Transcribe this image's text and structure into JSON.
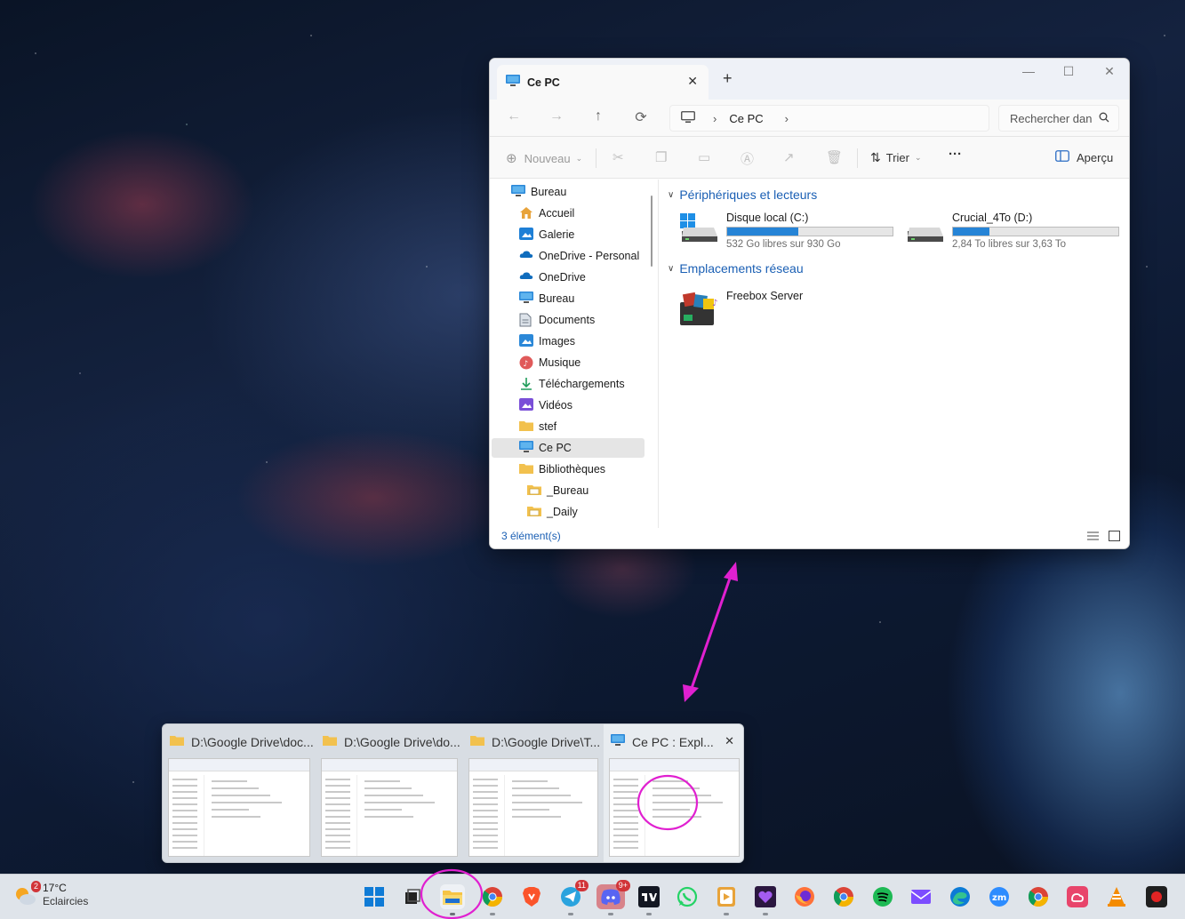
{
  "explorer": {
    "tab_title": "Ce PC",
    "breadcrumb": "Ce PC",
    "search_placeholder": "Rechercher dans Ce PC",
    "toolbar": {
      "new_label": "Nouveau",
      "sort_label": "Trier",
      "more_label": "···",
      "preview_label": "Aperçu"
    },
    "sidebar": [
      {
        "label": "Bureau",
        "icon": "desktop-icon"
      },
      {
        "label": "Accueil",
        "icon": "home-icon"
      },
      {
        "label": "Galerie",
        "icon": "gallery-icon"
      },
      {
        "label": "OneDrive - Personal",
        "icon": "onedrive-icon"
      },
      {
        "label": "OneDrive",
        "icon": "onedrive-icon"
      },
      {
        "label": "Bureau",
        "icon": "desktop-icon"
      },
      {
        "label": "Documents",
        "icon": "documents-icon"
      },
      {
        "label": "Images",
        "icon": "images-icon"
      },
      {
        "label": "Musique",
        "icon": "music-icon"
      },
      {
        "label": "Téléchargements",
        "icon": "downloads-icon"
      },
      {
        "label": "Vidéos",
        "icon": "videos-icon"
      },
      {
        "label": "stef",
        "icon": "folder-icon"
      },
      {
        "label": "Ce PC",
        "icon": "pc-icon",
        "selected": true
      },
      {
        "label": "Bibliothèques",
        "icon": "folder-icon"
      },
      {
        "label": "_Bureau",
        "icon": "library-icon"
      },
      {
        "label": "_Daily",
        "icon": "library-icon"
      }
    ],
    "sections": {
      "devices": "Périphériques et lecteurs",
      "network": "Emplacements réseau"
    },
    "drives": [
      {
        "name": "Disque local (C:)",
        "info": "532 Go libres sur 930 Go",
        "used_fraction": 0.43
      },
      {
        "name": "Crucial_4To (D:)",
        "info": "2,84 To libres sur 3,63 To",
        "used_fraction": 0.22
      }
    ],
    "network_items": [
      {
        "name": "Freebox Server"
      }
    ],
    "status": "3 élément(s)"
  },
  "taskbar_preview": {
    "thumbnails": [
      {
        "title": "D:\\Google Drive\\doc..."
      },
      {
        "title": "D:\\Google Drive\\do..."
      },
      {
        "title": "D:\\Google Drive\\T..."
      },
      {
        "title": "Ce PC : Expl..."
      }
    ]
  },
  "weather": {
    "temp": "17°C",
    "condition": "Eclaircies",
    "badge": "2"
  },
  "taskbar_badges": {
    "chrome_profile": "",
    "telegram": "11",
    "discord": "9+"
  },
  "colors": {
    "accent": "#1a5fb4",
    "drive_bar": "#2684d6",
    "annotation": "#e020d0"
  }
}
